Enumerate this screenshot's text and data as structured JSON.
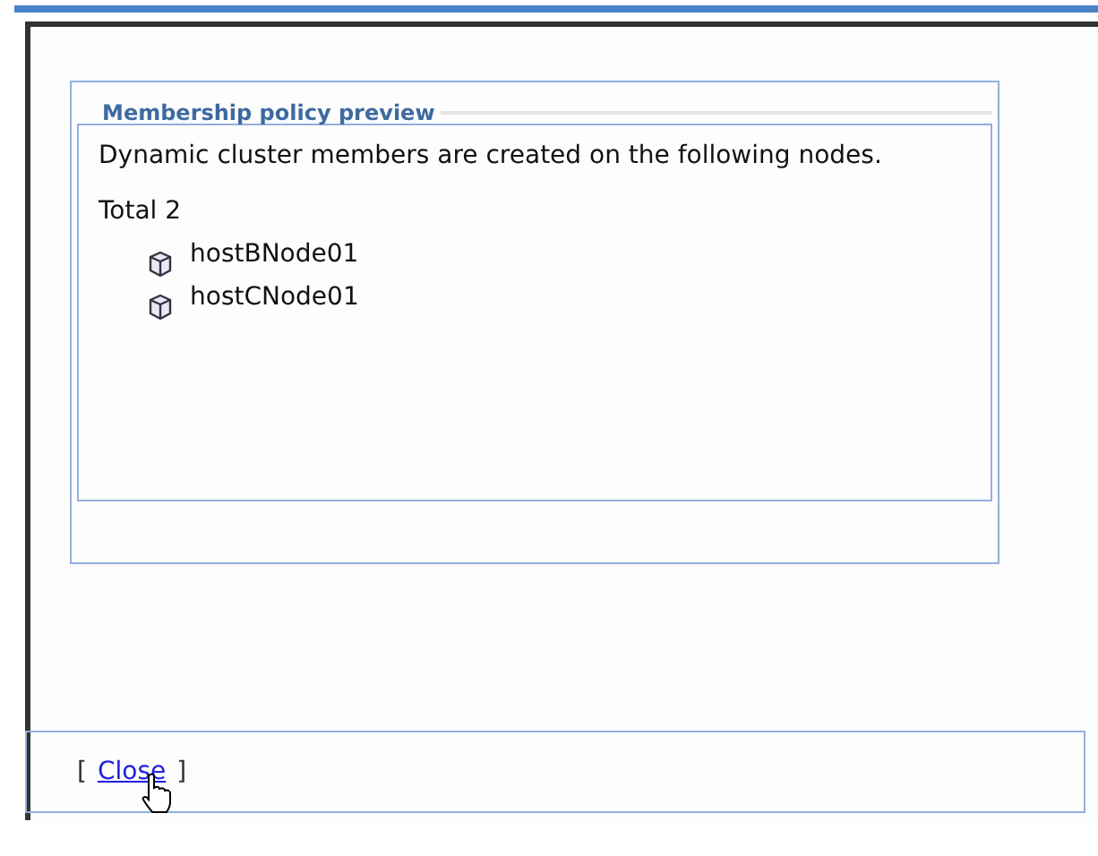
{
  "panel": {
    "legend": "Membership policy preview",
    "message": "Dynamic cluster members are created on the following nodes.",
    "total": "Total 2",
    "nodes": [
      {
        "name": "hostBNode01"
      },
      {
        "name": "hostCNode01"
      }
    ]
  },
  "footer": {
    "open_bracket": "[",
    "link": "Close",
    "close_bracket": "]"
  }
}
